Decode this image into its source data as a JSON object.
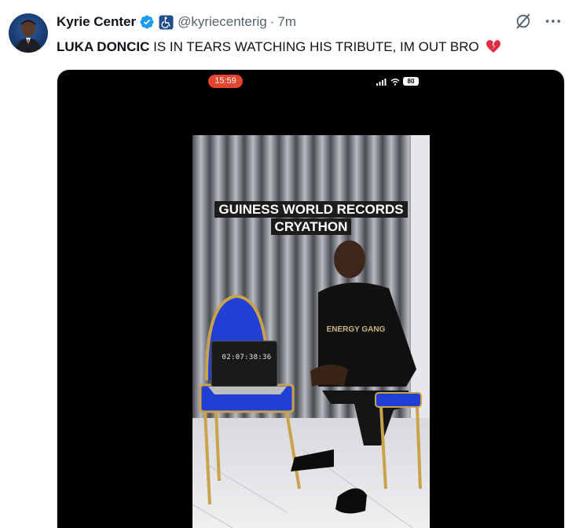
{
  "tweet": {
    "display_name": "Kyrie Center",
    "handle": "@kyriecenterig",
    "separator": "·",
    "time": "7m",
    "text_bold": "LUKA DONCIC",
    "text_rest": " IS IN TEARS WATCHING HIS TRIBUTE, IM OUT BRO",
    "emoji": "broken-heart-icon"
  },
  "icons": {
    "verified": "verified-badge-icon",
    "affiliate": "wheelchair-icon",
    "grok": "grok-icon",
    "more": "more-options-icon"
  },
  "video": {
    "status_time": "15:59",
    "battery": "80",
    "caption_line1": "GUINESS WORLD RECORDS",
    "caption_line2": "CRYATHON",
    "timer": "02:07:38:36",
    "shirt_text": "ENERGY GANG"
  },
  "colors": {
    "verified_blue": "#1d9bf0",
    "muted": "#536471",
    "status_red": "#e5452f",
    "chair_blue": "#1f3fd6",
    "chair_gold": "#c9a24a"
  }
}
